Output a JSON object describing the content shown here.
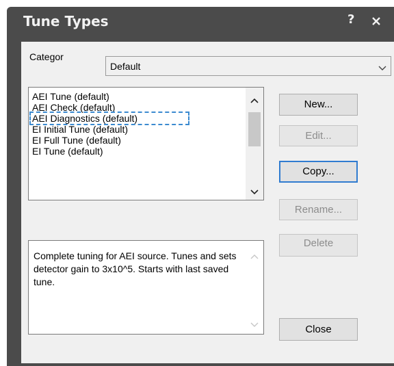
{
  "window": {
    "title": "Tune Types",
    "help_label": "?",
    "close_icon": "close-icon"
  },
  "category": {
    "label": "Categor",
    "selected": "Default"
  },
  "tune_list": {
    "items": [
      "AEI Tune (default)",
      "AEI Check (default)",
      "AEI Diagnostics (default)",
      "EI Initial Tune (default)",
      "EI Full Tune (default)",
      "EI Tune (default)"
    ],
    "focused_item": "AEI Diagnostics (default)"
  },
  "buttons": {
    "new": "New...",
    "edit": "Edit...",
    "copy": "Copy...",
    "rename": "Rename...",
    "delete": "Delete",
    "close": "Close"
  },
  "description": {
    "text": "Complete tuning for AEI source. Tunes and sets detector gain to 3x10^5. Starts with last saved tune."
  },
  "colors": {
    "titlebar": "#4b4b4b",
    "focus_outline": "#3a8ad0",
    "default_button_border": "#2f7bd0"
  }
}
